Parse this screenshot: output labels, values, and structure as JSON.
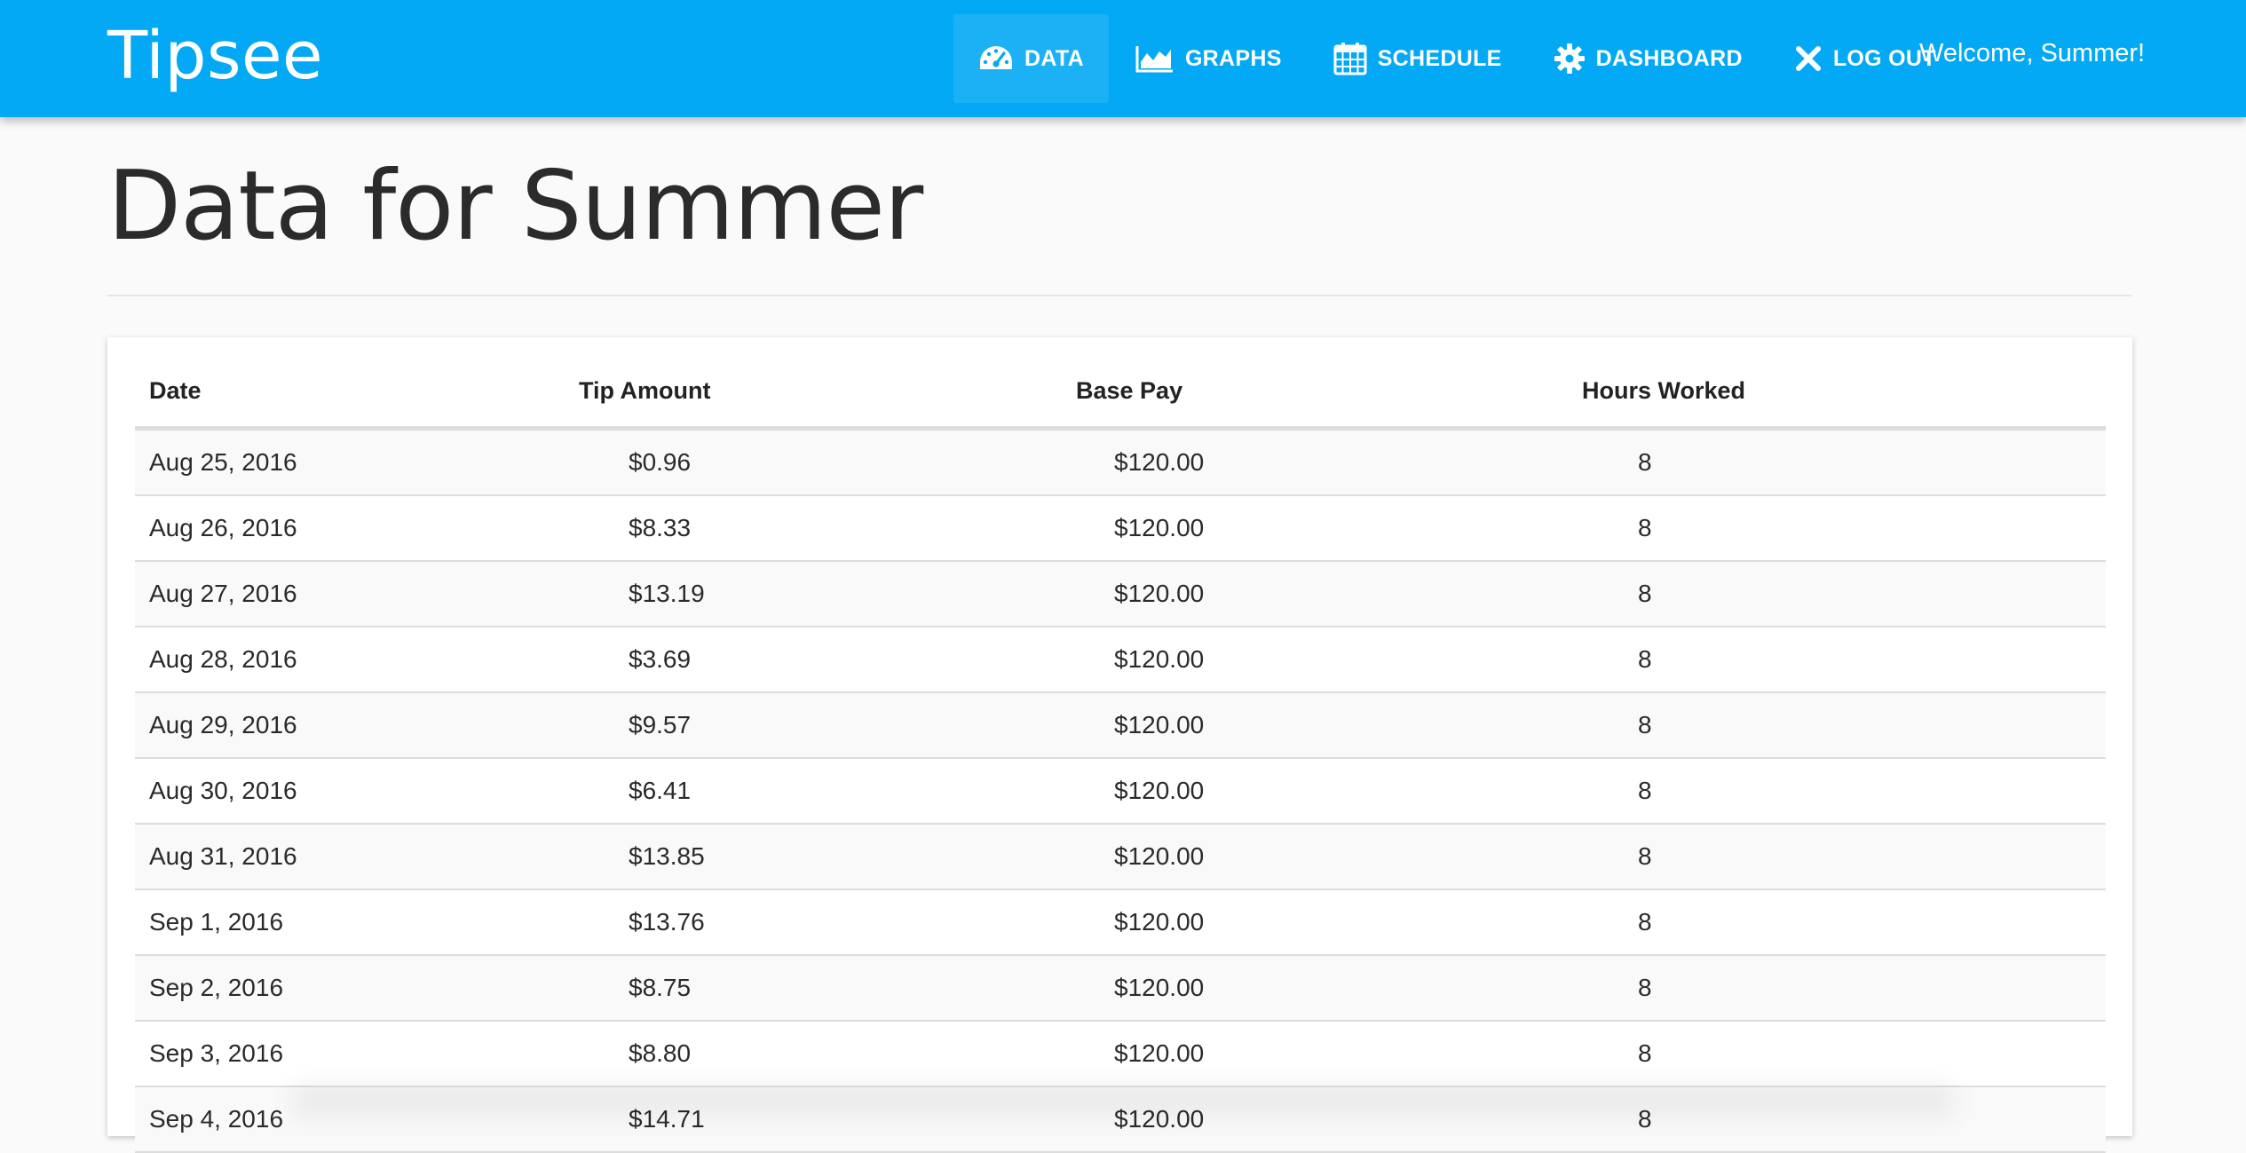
{
  "app": {
    "brand": "Tipsee",
    "welcome": "Welcome, Summer!",
    "accent_color": "#03a9f4"
  },
  "nav": {
    "items": [
      {
        "label": "DATA",
        "icon": "speedometer-icon",
        "active": true
      },
      {
        "label": "GRAPHS",
        "icon": "area-chart-icon",
        "active": false
      },
      {
        "label": "SCHEDULE",
        "icon": "calendar-icon",
        "active": false
      },
      {
        "label": "DASHBOARD",
        "icon": "gear-icon",
        "active": false
      },
      {
        "label": "LOG OUT",
        "icon": "close-icon",
        "active": false
      }
    ]
  },
  "page": {
    "title": "Data for Summer"
  },
  "table": {
    "columns": [
      "Date",
      "Tip Amount",
      "Base Pay",
      "Hours Worked"
    ],
    "rows": [
      [
        "Aug 25, 2016",
        "$0.96",
        "$120.00",
        "8"
      ],
      [
        "Aug 26, 2016",
        "$8.33",
        "$120.00",
        "8"
      ],
      [
        "Aug 27, 2016",
        "$13.19",
        "$120.00",
        "8"
      ],
      [
        "Aug 28, 2016",
        "$3.69",
        "$120.00",
        "8"
      ],
      [
        "Aug 29, 2016",
        "$9.57",
        "$120.00",
        "8"
      ],
      [
        "Aug 30, 2016",
        "$6.41",
        "$120.00",
        "8"
      ],
      [
        "Aug 31, 2016",
        "$13.85",
        "$120.00",
        "8"
      ],
      [
        "Sep 1, 2016",
        "$13.76",
        "$120.00",
        "8"
      ],
      [
        "Sep 2, 2016",
        "$8.75",
        "$120.00",
        "8"
      ],
      [
        "Sep 3, 2016",
        "$8.80",
        "$120.00",
        "8"
      ],
      [
        "Sep 4, 2016",
        "$14.71",
        "$120.00",
        "8"
      ]
    ]
  }
}
